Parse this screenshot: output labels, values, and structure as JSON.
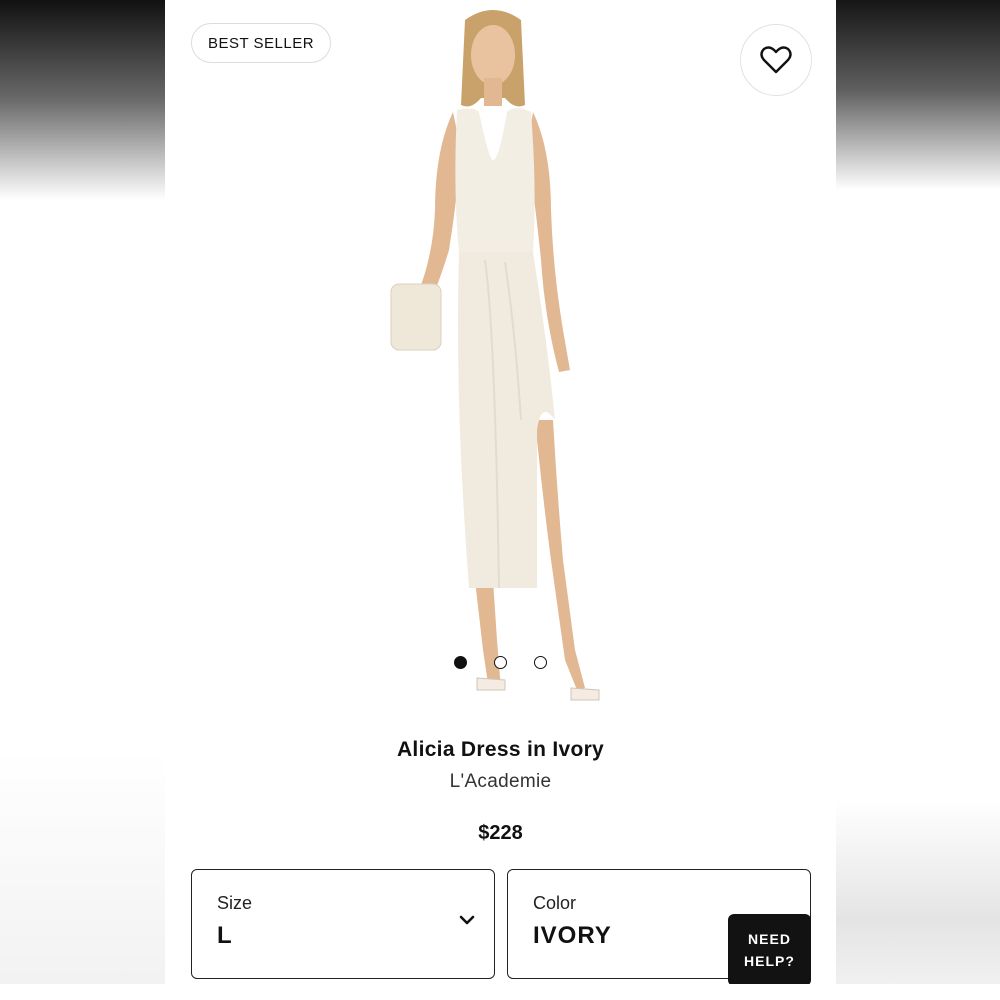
{
  "badge": {
    "label": "BEST SELLER"
  },
  "product": {
    "title": "Alicia Dress in Ivory",
    "brand": "L'Academie",
    "price": "$228"
  },
  "gallery": {
    "dot_count": 3,
    "active_index": 0
  },
  "size_select": {
    "label": "Size",
    "value": "L"
  },
  "color_select": {
    "label": "Color",
    "value": "IVORY"
  },
  "help_button": {
    "line1": "NEED",
    "line2": "HELP?"
  },
  "icons": {
    "favorite": "heart-icon",
    "dropdown": "chevron-down-icon"
  },
  "colors": {
    "accent": "#111111",
    "dress": "#f3eee3",
    "help_bg": "#121212"
  }
}
